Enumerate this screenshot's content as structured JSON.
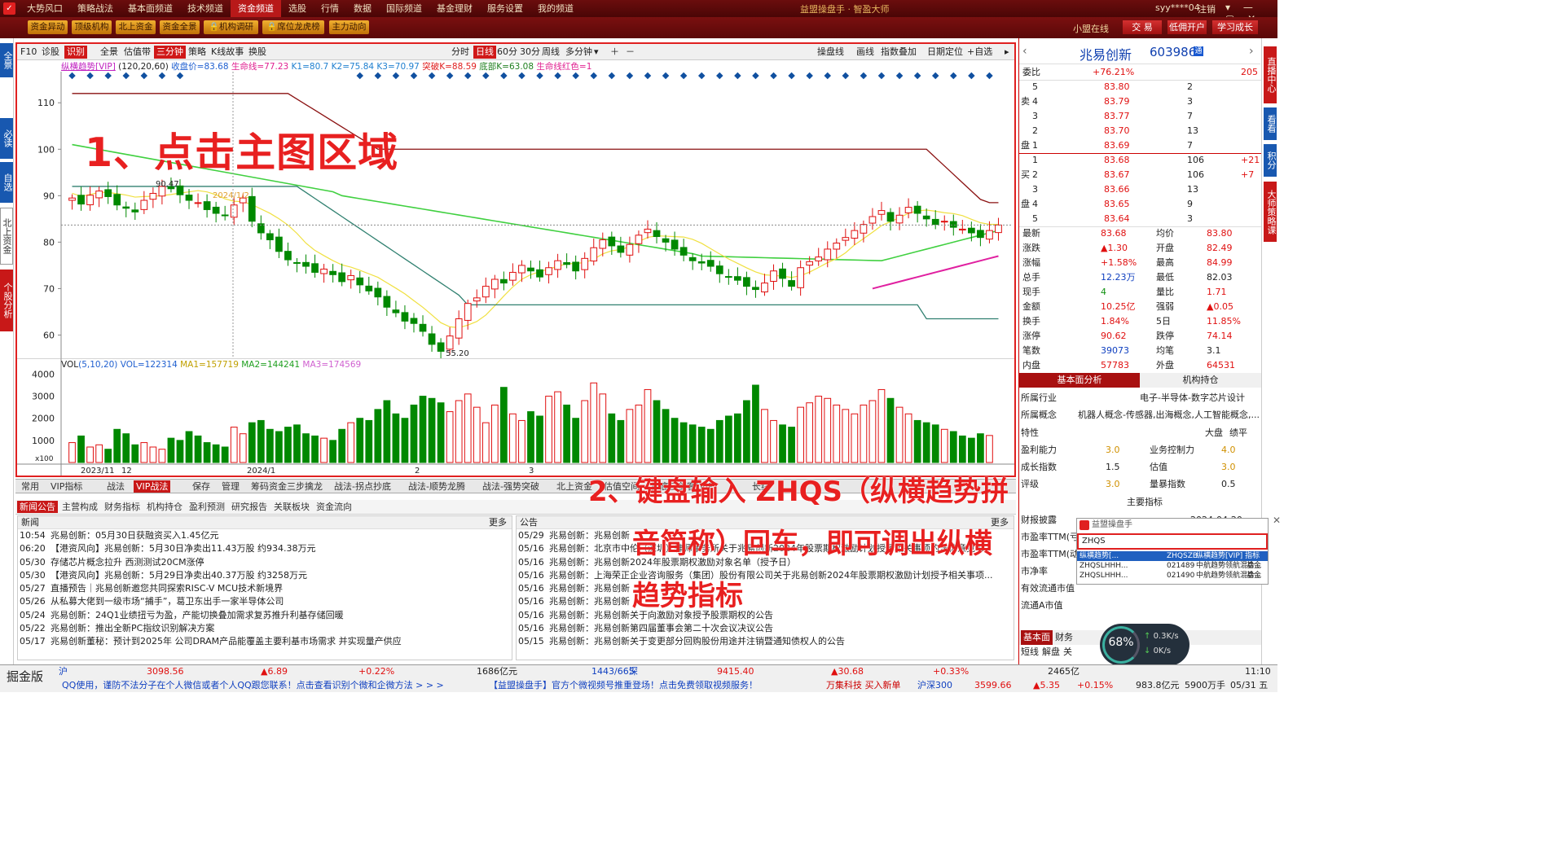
{
  "titlebar": {
    "menu": [
      "大势风口",
      "策略战法",
      "基本面频道",
      "技术频道",
      "资金频道",
      "选股",
      "行情",
      "数据",
      "国际频道",
      "基金理财",
      "服务设置",
      "我的频道"
    ],
    "active_menu": "资金频道",
    "app_title": "益盟操盘手 · 智盈大师",
    "user": "syy****04",
    "logout": "注销"
  },
  "toolbar": {
    "buttons": [
      "资金异动",
      "顶级机构",
      "北上资金",
      "资金全景",
      "机构调研",
      "席位龙虎榜",
      "主力动向"
    ],
    "online": "小盟在线",
    "right_buttons": [
      "交 易",
      "低佣开户",
      "学习成长"
    ]
  },
  "left_tabs": [
    "全景",
    "必读",
    "自选",
    "北上资金",
    "个股分析"
  ],
  "right_tabs": [
    "直播中心",
    "看看",
    "积分",
    "大师策略课"
  ],
  "chart_toolbar": {
    "left": [
      "F10",
      "诊股",
      "识别",
      "全景",
      "估值带",
      "三分钟",
      "策略",
      "K线故事",
      "换股"
    ],
    "periods": [
      "分时",
      "日线",
      "60分",
      "30分",
      "周线",
      "多分钟"
    ],
    "right": [
      "操盘线",
      "画线",
      "指数叠加",
      "日期定位",
      "+自选"
    ]
  },
  "indicator_legend": {
    "name": "纵横趋势[VIP]",
    "params": "(120,20,60)",
    "items": [
      "收盘价=83.68",
      "生命线=77.23",
      "K1=80.7",
      "K2=75.84",
      "K3=70.97",
      "突破K=88.59",
      "底部K=63.08",
      "生命线红色=1"
    ]
  },
  "vol_legend": {
    "name": "VOL",
    "params": "(5,10,20)",
    "items": [
      "VOL=122314",
      "MA1=157719",
      "MA2=144241",
      "MA3=174569"
    ]
  },
  "chart_data": [
    {
      "type": "candlestick",
      "title": "",
      "y_ticks": [
        60,
        70,
        80,
        90,
        100,
        110
      ],
      "ylim": [
        55,
        116
      ],
      "x_ticks": [
        "2023/11",
        "12",
        "2024/1",
        "2",
        "3"
      ],
      "annotations": [
        "90.47",
        "55.20",
        "2024/1/2",
        "B",
        "S"
      ],
      "series": [
        {
          "name": "close",
          "values": [
            89.5,
            88.2,
            90.1,
            91.0,
            89.8,
            88.0,
            87.3,
            86.5,
            89.0,
            90.5,
            92.0,
            91.5,
            90.2,
            89.0,
            88.5,
            87.0,
            86.2,
            85.8,
            88.0,
            89.5,
            84.5,
            82.0,
            80.5,
            78.0,
            76.2,
            75.5,
            74.8,
            73.5,
            74.2,
            73.0,
            71.5,
            72.8,
            70.8,
            69.5,
            68.2,
            66.0,
            64.8,
            63.0,
            62.5,
            60.8,
            58.0,
            56.5,
            59.8,
            63.5,
            66.8,
            68.0,
            70.5,
            72.0,
            71.2,
            73.5,
            75.0,
            73.8,
            72.5,
            74.5,
            76.0,
            75.2,
            73.8,
            76.5,
            78.8,
            80.5,
            79.2,
            77.8,
            79.5,
            81.5,
            82.8,
            81.2,
            80.0,
            78.5,
            77.2,
            76.0,
            75.5,
            74.8,
            73.2,
            72.5,
            71.8,
            70.5,
            69.8,
            71.2,
            73.8,
            72.2,
            70.5,
            74.5,
            75.8,
            76.8,
            78.5,
            79.8,
            81.0,
            82.5,
            83.8,
            85.5,
            86.8,
            84.5,
            85.8,
            87.5,
            86.2,
            85.0,
            83.8,
            84.5,
            83.2,
            82.8,
            82.0,
            81.0,
            82.5,
            83.68
          ]
        },
        {
          "name": "生命线",
          "values": [
            78,
            78.5,
            79,
            79.5,
            80,
            80.5,
            81,
            81.5,
            82,
            82.5,
            83,
            83.5,
            84,
            84.5,
            85
          ]
        }
      ]
    },
    {
      "type": "bar",
      "title": "",
      "y_ticks": [
        1000,
        2000,
        3000,
        4000
      ],
      "ylim": [
        0,
        4200
      ],
      "unit": "x100",
      "series": [
        {
          "name": "VOL",
          "values": [
            900,
            1200,
            700,
            800,
            600,
            1500,
            1300,
            800,
            900,
            700,
            600,
            1100,
            1000,
            1400,
            1200,
            900,
            800,
            700,
            1600,
            1300,
            1800,
            1900,
            1500,
            1400,
            1600,
            1700,
            1300,
            1200,
            1100,
            1000,
            1500,
            1800,
            2000,
            1900,
            2400,
            2800,
            2200,
            2000,
            2600,
            3000,
            2900,
            2700,
            2300,
            2800,
            3100,
            2500,
            1800,
            2600,
            3400,
            2200,
            1900,
            2300,
            2100,
            3000,
            3200,
            2600,
            2000,
            2800,
            3600,
            3100,
            2200,
            1900,
            2400,
            2600,
            3300,
            2800,
            2400,
            2000,
            1800,
            1700,
            1600,
            1500,
            1900,
            2100,
            2200,
            2800,
            3500,
            2400,
            1900,
            1700,
            1600,
            2500,
            2700,
            3000,
            2900,
            2600,
            2400,
            2200,
            2600,
            2800,
            3300,
            2900,
            2500,
            2200,
            1900,
            1800,
            1700,
            1500,
            1400,
            1200,
            1100,
            1300,
            1222
          ]
        }
      ]
    }
  ],
  "bottom_tabs_1": [
    "常用",
    "VIP指标",
    "战法",
    "VIP战法",
    "保存",
    "管理",
    "筹码资金三步擒龙",
    "战法-拐点抄底",
    "战法-顺势龙腾",
    "战法-强势突破",
    "北上资金",
    "估值空间",
    "抄底三剑客[VIP]",
    "长线"
  ],
  "bottom_tabs_2": [
    "新闻公告",
    "主营构成",
    "财务指标",
    "机构持仓",
    "盈利预测",
    "研究报告",
    "关联板块",
    "资金流向"
  ],
  "news": {
    "title": "新闻",
    "more": "更多",
    "items": [
      {
        "time": "10:54",
        "text": "兆易创新：05月30日获融资买入1.45亿元"
      },
      {
        "time": "06:20",
        "text": "【港资风向】兆易创新：5月30日净卖出11.43万股 约934.38万元"
      },
      {
        "time": "05/30",
        "text": "存储芯片概念拉升 西测测试20CM涨停"
      },
      {
        "time": "05/30",
        "text": "【港资风向】兆易创新：5月29日净卖出40.37万股 约3258万元"
      },
      {
        "time": "05/27",
        "text": "直播预告｜兆易创新邀您共同探索RISC-V MCU技术新境界"
      },
      {
        "time": "05/26",
        "text": "从私募大佬到一级市场“捕手”，葛卫东出手一家半导体公司"
      },
      {
        "time": "05/24",
        "text": "兆易创新：24Q1业绩扭亏为盈，产能切换叠加需求复苏推升利基存储回暖"
      },
      {
        "time": "05/22",
        "text": "兆易创新：推出全新PC指纹识别解决方案"
      },
      {
        "time": "05/17",
        "text": "兆易创新董秘：预计到2025年 公司DRAM产品能覆盖主要利基市场需求 并实现量产供应"
      }
    ]
  },
  "notices": {
    "title": "公告",
    "more": "更多",
    "items": [
      {
        "time": "05/29",
        "text": "兆易创新：兆易创新"
      },
      {
        "time": "05/16",
        "text": "兆易创新：北京市中伦（深圳）律师事务所关于兆易创新2024年股票期权激励计划授予相关事项的法律意见书"
      },
      {
        "time": "05/16",
        "text": "兆易创新：兆易创新2024年股票期权激励对象名单（授予日）"
      },
      {
        "time": "05/16",
        "text": "兆易创新：上海荣正企业咨询服务（集团）股份有限公司关于兆易创新2024年股票期权激励计划授予相关事项..."
      },
      {
        "time": "05/16",
        "text": "兆易创新：兆易创新"
      },
      {
        "time": "05/16",
        "text": "兆易创新：兆易创新"
      },
      {
        "time": "05/16",
        "text": "兆易创新：兆易创新关于向激励对象授予股票期权的公告"
      },
      {
        "time": "05/16",
        "text": "兆易创新：兆易创新第四届董事会第二十次会议决议公告"
      },
      {
        "time": "05/15",
        "text": "兆易创新：兆易创新关于变更部分回购股份用途并注销暨通知债权人的公告"
      }
    ]
  },
  "stock": {
    "name": "兆易创新",
    "code": "603986",
    "weibi_label": "委比",
    "weibi": "+76.21%",
    "weicha": "205",
    "sell_label": [
      "卖",
      "盘"
    ],
    "buy_label": [
      "买",
      "盘"
    ],
    "sells": [
      {
        "n": "5",
        "p": "83.80",
        "v": "2"
      },
      {
        "n": "4",
        "p": "83.79",
        "v": "3"
      },
      {
        "n": "3",
        "p": "83.77",
        "v": "7"
      },
      {
        "n": "2",
        "p": "83.70",
        "v": "13"
      },
      {
        "n": "1",
        "p": "83.69",
        "v": "7"
      }
    ],
    "buys": [
      {
        "n": "1",
        "p": "83.68",
        "v": "106",
        "c": "+21"
      },
      {
        "n": "2",
        "p": "83.67",
        "v": "106",
        "c": "+7"
      },
      {
        "n": "3",
        "p": "83.66",
        "v": "13",
        "c": ""
      },
      {
        "n": "4",
        "p": "83.65",
        "v": "9",
        "c": ""
      },
      {
        "n": "5",
        "p": "83.64",
        "v": "3",
        "c": ""
      }
    ],
    "stats": [
      {
        "l1": "最新",
        "v1": "83.68",
        "l2": "均价",
        "v2": "83.80"
      },
      {
        "l1": "涨跌",
        "v1": "▲1.30",
        "l2": "开盘",
        "v2": "82.49"
      },
      {
        "l1": "涨幅",
        "v1": "+1.58%",
        "l2": "最高",
        "v2": "84.99"
      },
      {
        "l1": "总手",
        "v1": "12.23万",
        "l2": "最低",
        "v2": "82.03"
      },
      {
        "l1": "现手",
        "v1": "4",
        "l2": "量比",
        "v2": "1.71"
      },
      {
        "l1": "金额",
        "v1": "10.25亿",
        "l2": "强弱",
        "v2": "▲0.05"
      },
      {
        "l1": "换手",
        "v1": "1.84%",
        "l2": "5日",
        "v2": "11.85%"
      },
      {
        "l1": "涨停",
        "v1": "90.62",
        "l2": "跌停",
        "v2": "74.14"
      },
      {
        "l1": "笔数",
        "v1": "39073",
        "l2": "均笔",
        "v2": "3.1"
      },
      {
        "l1": "内盘",
        "v1": "57783",
        "l2": "外盘",
        "v2": "64531"
      }
    ],
    "tabs": [
      "基本面分析",
      "机构持仓"
    ],
    "industry_label": "所属行业",
    "industry": "电子-半导体-数字芯片设计",
    "concept_label": "所属概念",
    "concept": "机器人概念-传感器,出海概念,人工智能概念,...",
    "feature_label": "特性",
    "features": [
      "大盘",
      "绩平"
    ],
    "ratings": [
      {
        "l": "盈利能力",
        "v": "3.0",
        "l2": "业务控制力",
        "v2": "4.0"
      },
      {
        "l": "成长指数",
        "v": "1.5",
        "l2": "估值",
        "v2": "3.0"
      },
      {
        "l": "评级",
        "v": "3.0",
        "l2": "量暴指数",
        "v2": "0.5"
      }
    ],
    "main_indicators": "主要指标",
    "fin_labels": [
      "财报披露",
      "市盈率TTM(亏)",
      "市盈率TTM(动)",
      "市净率",
      "有效流通市值",
      "流通A市值"
    ],
    "fin_date": "2024-04-20",
    "bottom_tabs": [
      "基本面",
      "财务"
    ],
    "bottom_tabs2": [
      "短线",
      "解盘",
      "关"
    ]
  },
  "popup": {
    "title": "益盟操盘手",
    "input": "ZHQS",
    "results": [
      {
        "name": "纵横趋势[...",
        "code": "ZHQSZB",
        "desc": "纵横趋势[VIP] 指标"
      },
      {
        "name": "ZHQSLHHH...",
        "code": "021489",
        "desc": "中航趋势领航混合...",
        "type": "基金"
      },
      {
        "name": "ZHQSLHHH...",
        "code": "021490",
        "desc": "中航趋势领航混合...",
        "type": "基金"
      }
    ]
  },
  "gauge": {
    "percent": "68%",
    "up": "0.3K/s",
    "down": "0K/s"
  },
  "annotations": {
    "step1": "1、点击主图区域",
    "step2_line1": "2、键盘输入 ZHQS（纵横趋势拼",
    "step2_line2": "音简称）回车，即可调出纵横",
    "step2_line3": "趋势指标"
  },
  "statusbar": {
    "brand": "掘金版",
    "sh_label": "沪",
    "sh_index": "3098.56",
    "sh_change": "▲6.89",
    "sh_pct": "+0.22%",
    "sh_amount": "1686亿元",
    "updown": "1443/665",
    "sz_label": "深",
    "sz_index": "9415.40",
    "sz_change": "▲30.68",
    "sz_pct": "+0.33%",
    "sz_amount": "2465亿",
    "ticker": "QQ使用，谨防不法分子在个人微信或者个人QQ跟您联系！点击查看识别个微和企微方法 > > >",
    "ticker2": "【益盟操盘手】官方个微视频号推重登场！点击免费领取视频服务！",
    "news2": "万集科技 买入新单",
    "hs300_label": "沪深300",
    "hs300": "3599.66",
    "hs300_change": "▲5.35",
    "hs300_pct": "+0.15%",
    "hs300_amount": "983.8亿元",
    "hs300_vol": "5900万手",
    "date": "05/31 五",
    "time": "11:10"
  },
  "colors": {
    "up": "#e01010",
    "down": "#008800",
    "accent": "#b81919",
    "lifeline": "#e020a0",
    "band": "#8a1010"
  }
}
